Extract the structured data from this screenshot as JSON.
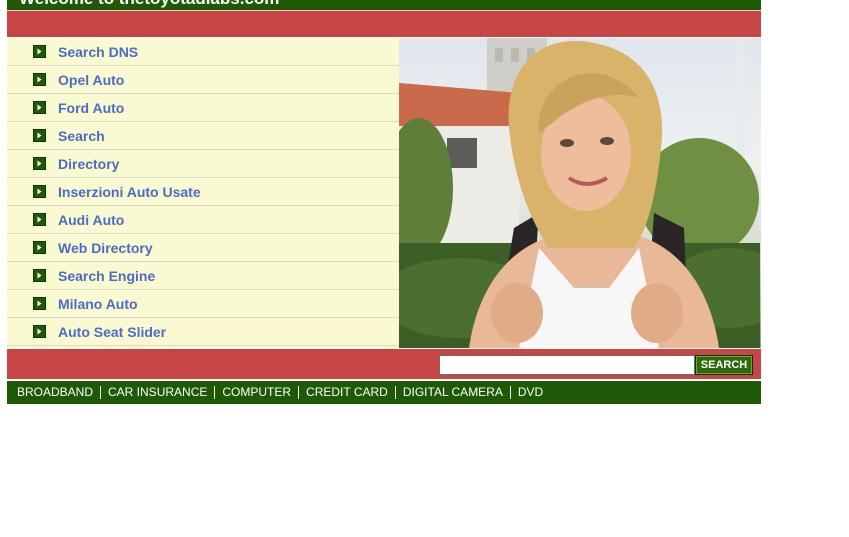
{
  "header": {
    "welcome": "Welcome to thetoyotadlabs.com"
  },
  "sidebar": {
    "items": [
      {
        "label": "Search DNS"
      },
      {
        "label": "Opel Auto"
      },
      {
        "label": "Ford Auto"
      },
      {
        "label": "Search"
      },
      {
        "label": "Directory"
      },
      {
        "label": "Inserzioni Auto Usate"
      },
      {
        "label": "Audi Auto"
      },
      {
        "label": "Web Directory"
      },
      {
        "label": "Search Engine"
      },
      {
        "label": "Milano Auto"
      },
      {
        "label": "Auto Seat Slider"
      }
    ]
  },
  "search": {
    "value": "",
    "button_label": "SEARCH"
  },
  "bottom_nav": {
    "links": [
      "BROADBAND",
      "CAR INSURANCE",
      "COMPUTER",
      "CREDIT CARD",
      "DIGITAL CAMERA",
      "DVD"
    ]
  },
  "colors": {
    "green": "#1e5a06",
    "red": "#c84545",
    "sidebar_bg": "#fafad2",
    "link_blue": "#4b6cc2"
  }
}
